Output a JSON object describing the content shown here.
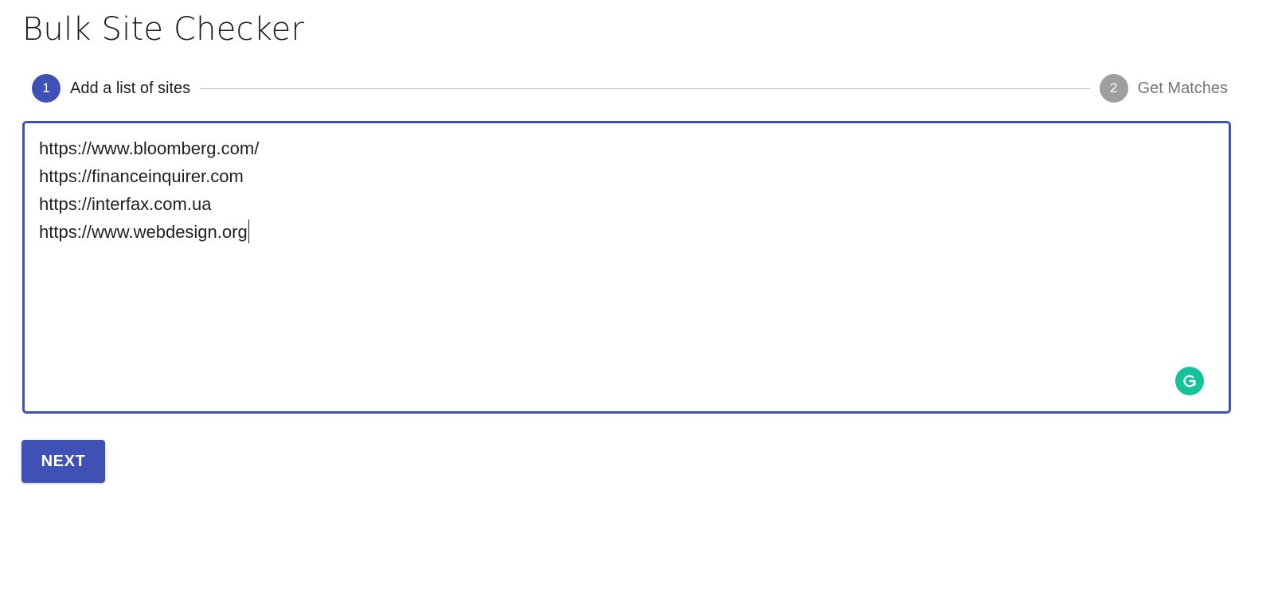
{
  "page": {
    "title": "Bulk Site Checker"
  },
  "stepper": {
    "steps": [
      {
        "number": "1",
        "label": "Add a list of sites",
        "state": "active"
      },
      {
        "number": "2",
        "label": "Get Matches",
        "state": "inactive"
      }
    ]
  },
  "editor": {
    "lines": [
      "https://www.bloomberg.com/",
      "https://financeinquirer.com",
      "https://interfax.com.ua",
      "https://www.webdesign.org"
    ],
    "assist_icon": "grammar-assistant-icon"
  },
  "actions": {
    "next_label": "NEXT"
  },
  "colors": {
    "primary": "#3f51b5",
    "step_inactive": "#9e9e9e",
    "assist_green": "#15c39a"
  }
}
